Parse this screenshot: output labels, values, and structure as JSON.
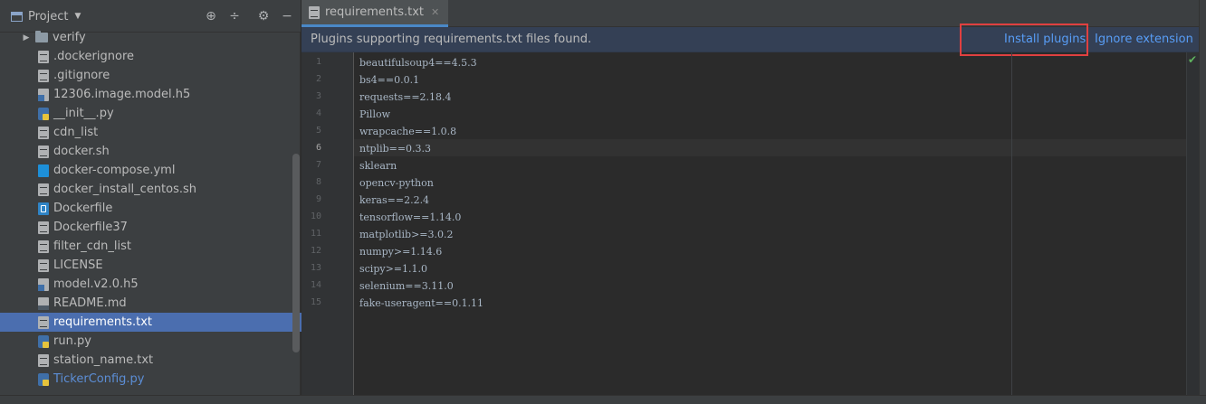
{
  "project_panel": {
    "title": "Project",
    "header_icons": [
      "target-icon",
      "collapse-icon",
      "gear-icon",
      "minimize-icon"
    ]
  },
  "tree": [
    {
      "label": "verify",
      "icon": "folder",
      "kind": "folder"
    },
    {
      "label": ".dockerignore",
      "icon": "txt"
    },
    {
      "label": ".gitignore",
      "icon": "txt"
    },
    {
      "label": "12306.image.model.h5",
      "icon": "h5"
    },
    {
      "label": "__init__.py",
      "icon": "py"
    },
    {
      "label": "cdn_list",
      "icon": "txt"
    },
    {
      "label": "docker.sh",
      "icon": "txt"
    },
    {
      "label": "docker-compose.yml",
      "icon": "yml"
    },
    {
      "label": "docker_install_centos.sh",
      "icon": "txt"
    },
    {
      "label": "Dockerfile",
      "icon": "docker"
    },
    {
      "label": "Dockerfile37",
      "icon": "txt"
    },
    {
      "label": "filter_cdn_list",
      "icon": "txt"
    },
    {
      "label": "LICENSE",
      "icon": "txt"
    },
    {
      "label": "model.v2.0.h5",
      "icon": "h5"
    },
    {
      "label": "README.md",
      "icon": "md"
    },
    {
      "label": "requirements.txt",
      "icon": "txt",
      "selected": true
    },
    {
      "label": "run.py",
      "icon": "py"
    },
    {
      "label": "station_name.txt",
      "icon": "txt"
    },
    {
      "label": "TickerConfig.py",
      "icon": "py",
      "modified": true
    }
  ],
  "editor": {
    "tab_label": "requirements.txt",
    "notification": {
      "text": "Plugins supporting requirements.txt files found.",
      "install_label": "Install plugins",
      "ignore_label": "Ignore extension"
    },
    "current_line": 6,
    "lines": [
      "beautifulsoup4==4.5.3",
      "bs4==0.0.1",
      "requests==2.18.4",
      "Pillow",
      "wrapcache==1.0.8",
      "ntplib==0.3.3",
      "sklearn",
      "opencv-python",
      "keras==2.2.4",
      "tensorflow==1.14.0",
      "matplotlib>=3.0.2",
      "numpy>=1.14.6",
      "scipy>=1.1.0",
      "selenium==3.11.0",
      "fake-useragent==0.1.11"
    ]
  },
  "colors": {
    "accent": "#4a88c7",
    "link": "#589df6",
    "selection": "#4b6eaf",
    "highlight_box": "#e04040"
  }
}
